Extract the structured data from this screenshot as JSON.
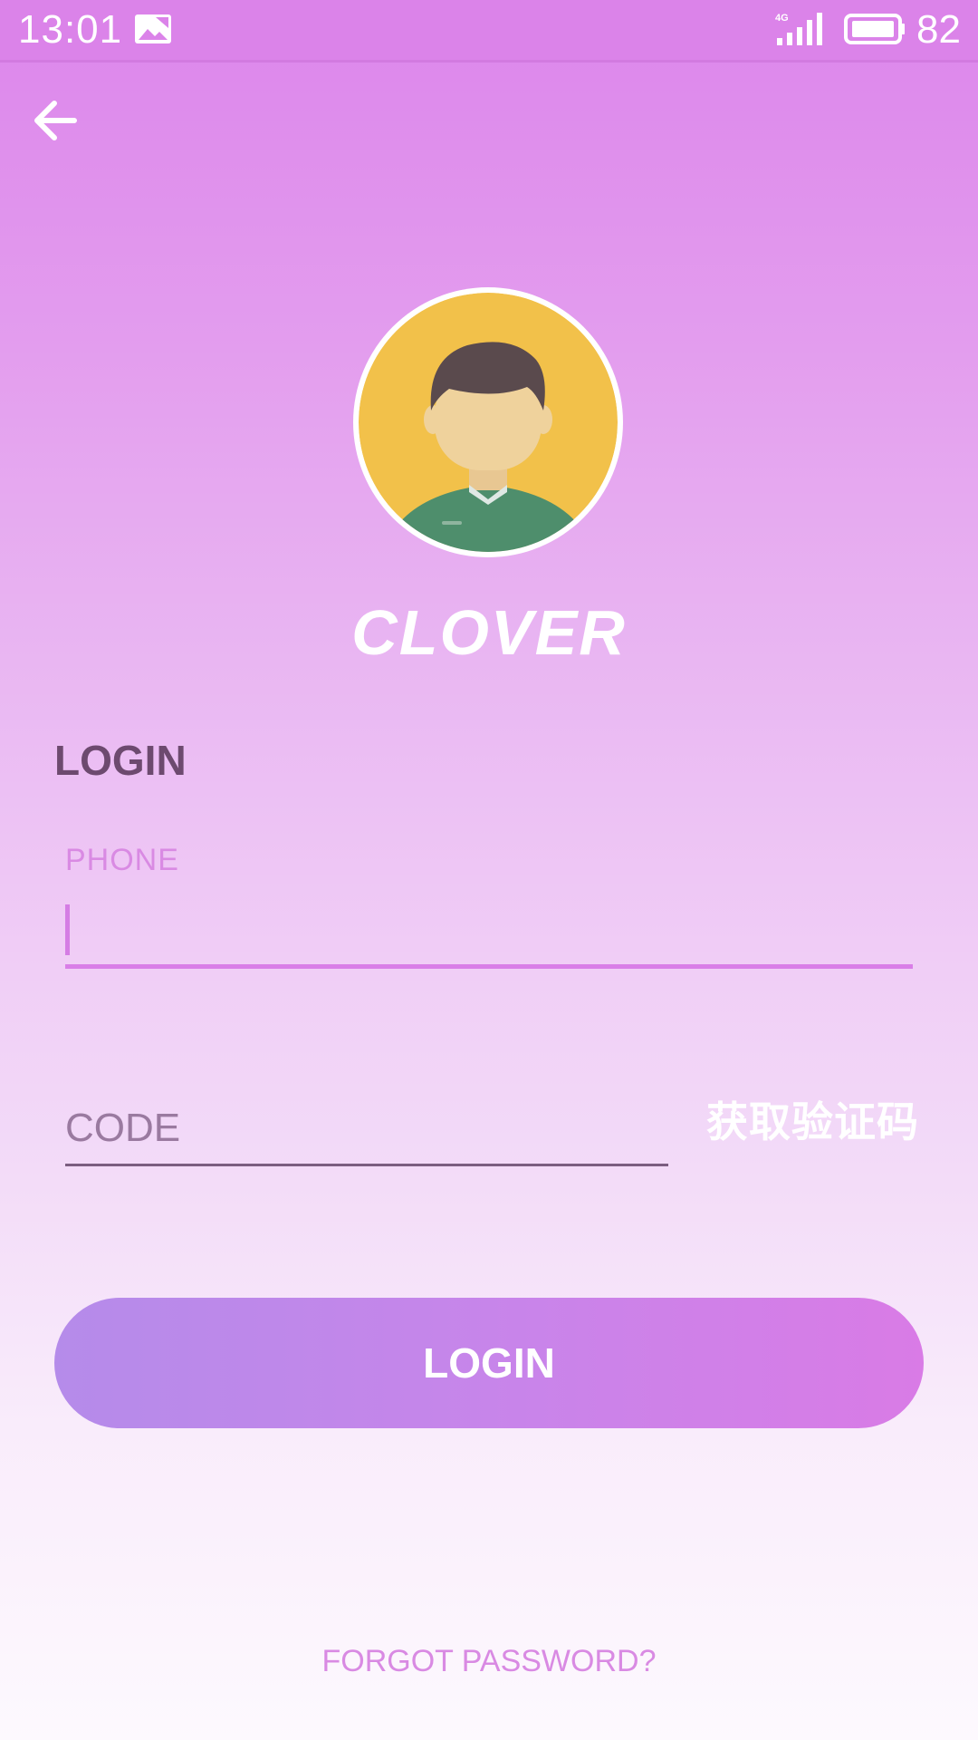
{
  "status_bar": {
    "time": "13:01",
    "network": "4G",
    "battery": "82"
  },
  "brand": {
    "name": "CLOVER"
  },
  "form": {
    "title": "LOGIN",
    "phone_label": "PHONE",
    "phone_value": "",
    "code_placeholder": "CODE",
    "code_value": "",
    "get_code_label": "获取验证码",
    "login_label": "LOGIN",
    "forgot_label": "FORGOT PASSWORD?"
  },
  "colors": {
    "accent": "#d97ee7",
    "text_dark": "#6d4a6f",
    "button_start": "#b58bea",
    "button_end": "#d97be6"
  },
  "icons": {
    "back": "arrow-left-icon",
    "gallery": "image-icon",
    "signal": "signal-icon",
    "battery": "battery-icon"
  }
}
